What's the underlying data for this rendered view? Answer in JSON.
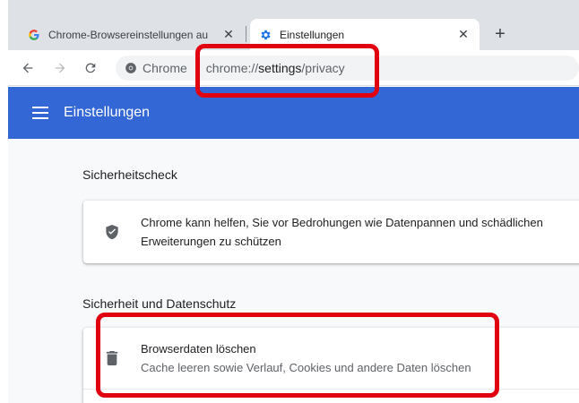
{
  "tabs": [
    {
      "title": "Chrome-Browsereinstellungen au",
      "favicon": "google-g-icon",
      "active": false
    },
    {
      "title": "Einstellungen",
      "favicon": "gear-icon",
      "active": true
    }
  ],
  "toolbar": {
    "back": "back-arrow-icon",
    "forward": "forward-arrow-icon",
    "reload": "reload-icon",
    "chip_label": "Chrome",
    "url_scheme": "chrome://",
    "url_host": "settings",
    "url_path": "/privacy"
  },
  "header": {
    "title": "Einstellungen"
  },
  "sections": {
    "safety_check": {
      "title": "Sicherheitscheck",
      "line1": "Chrome kann helfen, Sie vor Bedrohungen wie Datenpannen und schädlichen",
      "line2": "Erweiterungen zu schützen"
    },
    "privacy": {
      "title": "Sicherheit und Datenschutz",
      "clear_title": "Browserdaten löschen",
      "clear_sub": "Cache leeren sowie Verlauf, Cookies und andere Daten löschen"
    }
  },
  "colors": {
    "header_bg": "#3367d6",
    "highlight": "#e0000f",
    "tabstrip": "#dee1e6"
  }
}
